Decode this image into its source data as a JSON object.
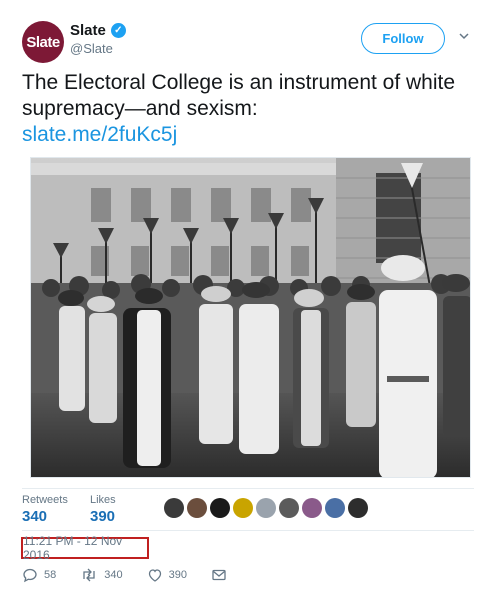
{
  "account": {
    "avatar_text": "Slate",
    "avatar_color": "#7d1936",
    "name": "Slate",
    "verified_icon": "verified-badge-icon",
    "handle": "@Slate"
  },
  "header": {
    "follow_label": "Follow",
    "menu_icon": "chevron-down-icon"
  },
  "tweet": {
    "text": "The Electoral College is an instrument of white supremacy—and sexism:",
    "link": "slate.me/2fuKc5j",
    "link_color": "#1b95e0"
  },
  "media": {
    "description_icon": "photo",
    "palette": "black-and-white"
  },
  "stats": {
    "retweets_label": "Retweets",
    "retweets_value": "340",
    "likes_label": "Likes",
    "likes_value": "390"
  },
  "timestamp": "11:21 PM - 12 Nov 2016",
  "actions": {
    "replies": "58",
    "retweets": "340",
    "likes": "390",
    "reply_icon": "reply-icon",
    "retweet_icon": "retweet-icon",
    "like_icon": "heart-icon",
    "dm_icon": "envelope-icon"
  },
  "colors": {
    "accent": "#1da1f2",
    "highlight_border": "#c02020",
    "muted": "#657786"
  }
}
